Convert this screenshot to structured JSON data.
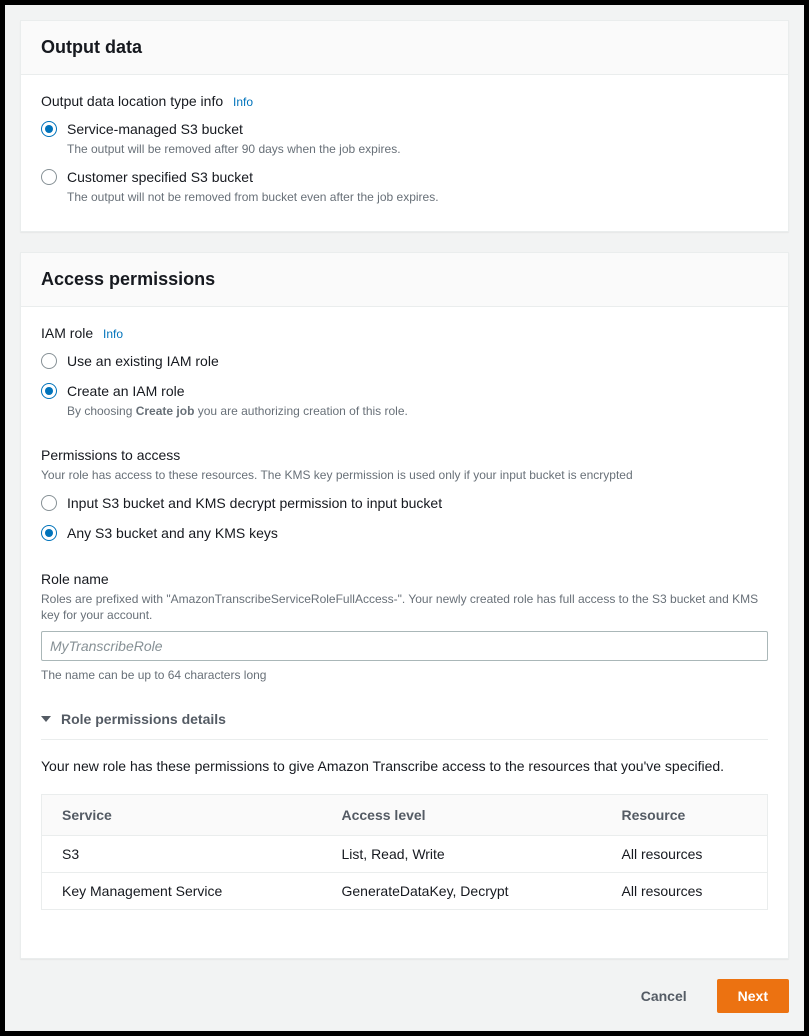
{
  "info_label": "Info",
  "output_panel": {
    "title": "Output data",
    "location_label": "Output data location type info",
    "options": [
      {
        "label": "Service-managed S3 bucket",
        "desc": "The output will be removed after 90 days when the job expires.",
        "selected": true
      },
      {
        "label": "Customer specified S3 bucket",
        "desc": "The output will not be removed from bucket even after the job expires.",
        "selected": false
      }
    ]
  },
  "access_panel": {
    "title": "Access permissions",
    "iam_label": "IAM role",
    "iam_options": [
      {
        "label": "Use an existing IAM role",
        "selected": false
      },
      {
        "label": "Create an IAM role",
        "selected": true
      }
    ],
    "iam_create_desc_pre": "By choosing ",
    "iam_create_desc_bold": "Create job",
    "iam_create_desc_post": " you are authorizing creation of this role.",
    "perm_access_label": "Permissions to access",
    "perm_access_hint": "Your role has access to these resources. The KMS key permission is used only if your input bucket is encrypted",
    "perm_options": [
      {
        "label": "Input S3 bucket and KMS decrypt permission to input bucket",
        "selected": false
      },
      {
        "label": "Any S3 bucket and any KMS keys",
        "selected": true
      }
    ],
    "role_name_label": "Role name",
    "role_name_hint": "Roles are prefixed with \"AmazonTranscribeServiceRoleFullAccess-\". Your newly created role has full access to the S3 bucket and KMS key for your account.",
    "role_name_placeholder": "MyTranscribeRole",
    "role_name_constraint": "The name can be up to 64 characters long",
    "details_title": "Role permissions details",
    "details_intro": "Your new role has these permissions to give Amazon Transcribe access to the resources that you've specified.",
    "table": {
      "headers": [
        "Service",
        "Access level",
        "Resource"
      ],
      "rows": [
        [
          "S3",
          "List, Read, Write",
          "All resources"
        ],
        [
          "Key Management Service",
          "GenerateDataKey, Decrypt",
          "All resources"
        ]
      ]
    }
  },
  "footer": {
    "cancel": "Cancel",
    "next": "Next"
  }
}
